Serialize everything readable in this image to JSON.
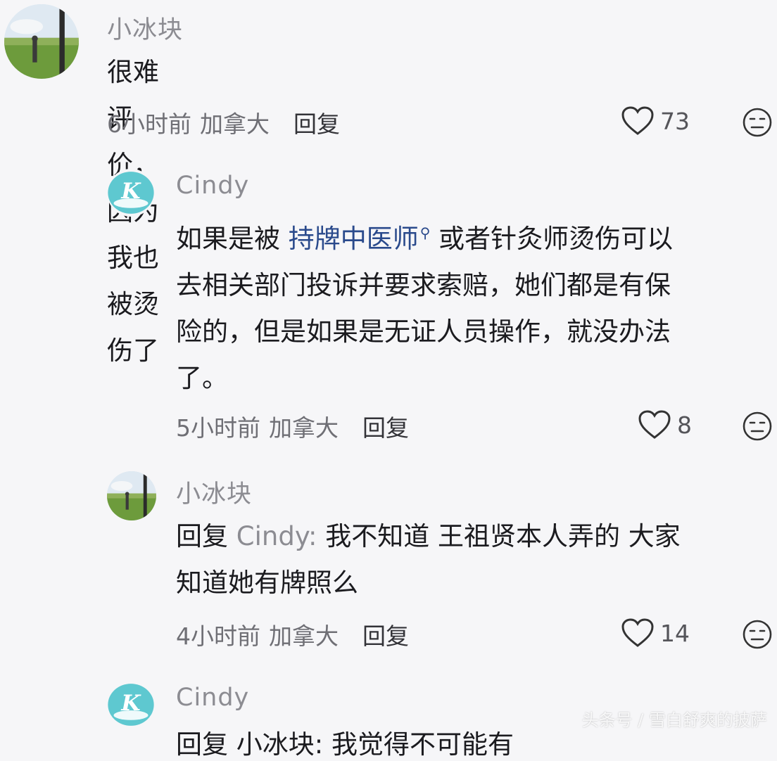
{
  "comments": [
    {
      "author": "小冰块",
      "avatar": "landscape-avatar",
      "text": "很难评价，因为我也被烫伤了",
      "time": "6小时前",
      "location": "加拿大",
      "reply_label": "回复",
      "likes": "73"
    },
    {
      "author": "Cindy",
      "avatar": "k-logo-avatar",
      "text_before": "如果是被 ",
      "link_text": "持牌中医师",
      "text_after_1": " 或者针灸师烫伤可以",
      "text_line2": "去相关部门投诉并要求索赔，她们都是有保",
      "text_line3": "险的，但是如果是无证人员操作，就没办法",
      "text_line4": "了。",
      "time": "5小时前",
      "location": "加拿大",
      "reply_label": "回复",
      "likes": "8"
    },
    {
      "author": "小冰块",
      "avatar": "landscape-avatar",
      "reply_prefix": "回复 ",
      "reply_target": "Cindy:",
      "text_line1": " 我不知道 王祖贤本人弄的 大家",
      "text_line2": "知道她有牌照么",
      "time": "4小时前",
      "location": "加拿大",
      "reply_label": "回复",
      "likes": "14"
    },
    {
      "author": "Cindy",
      "avatar": "k-logo-avatar",
      "partial_text": "回复 小冰块: 我觉得不可能有"
    }
  ],
  "watermark": "头条号 / 雪白舒爽的披萨",
  "colors": {
    "accent_link": "#2a4a8c",
    "avatar_teal": "#5ec8d0",
    "muted": "#8c8c92"
  }
}
